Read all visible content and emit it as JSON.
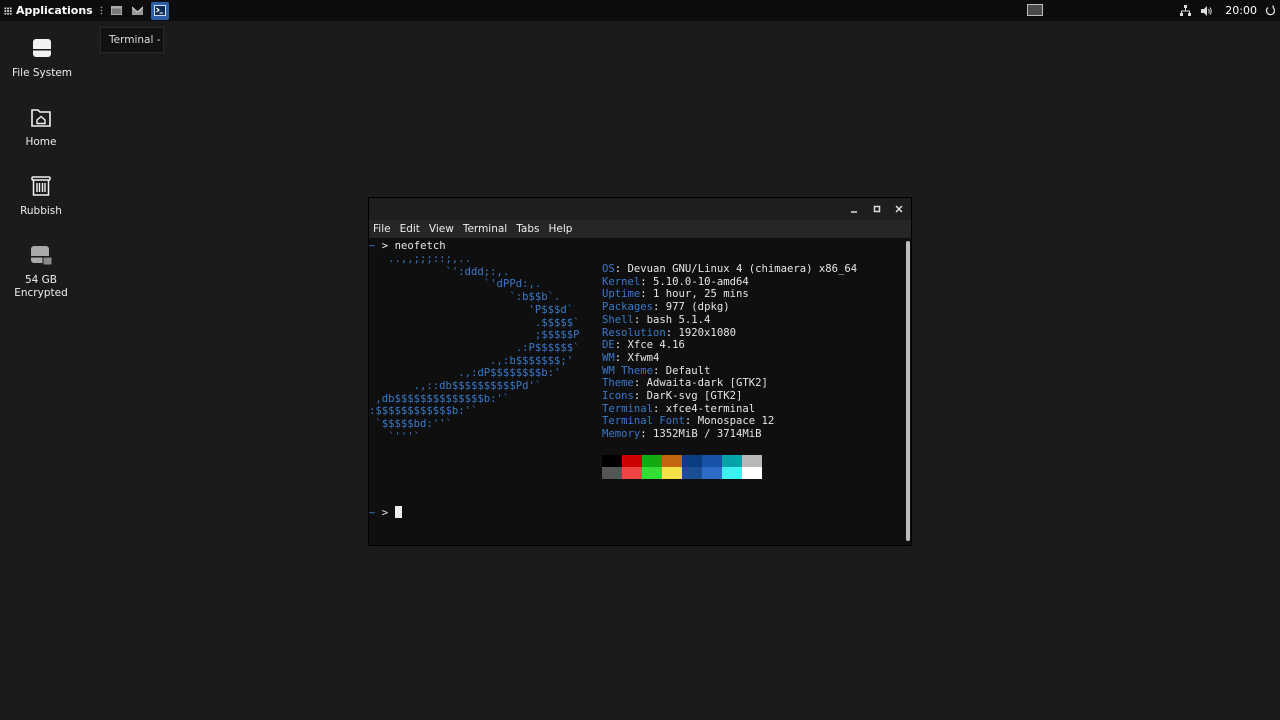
{
  "panel": {
    "applications_label": "Applications",
    "clock": "20:00",
    "launchers": [
      "file-manager",
      "mail-client",
      "terminal"
    ]
  },
  "tooltip": {
    "text": "Terminal -"
  },
  "desktop": {
    "icons": [
      {
        "name": "file-system",
        "label": "File System"
      },
      {
        "name": "home",
        "label": "Home"
      },
      {
        "name": "rubbish",
        "label": "Rubbish"
      },
      {
        "name": "drive",
        "label_line1": "54 GB",
        "label_line2": "Encrypted"
      }
    ]
  },
  "terminal": {
    "menu": [
      "File",
      "Edit",
      "View",
      "Terminal",
      "Tabs",
      "Help"
    ],
    "command": "neofetch",
    "prompt_char": ">",
    "prompt_tilde": "~",
    "logo_lines": [
      "   ..,,;;;::;,..",
      "            `':ddd;:,.",
      "                  `'dPPd:,.",
      "                      `:b$$b`.",
      "                         'P$$$d`",
      "                          .$$$$$`",
      "                          ;$$$$$P",
      "                       .:P$$$$$$`",
      "                   .,:b$$$$$$$;'",
      "              .,:dP$$$$$$$$b:'",
      "       .,::db$$$$$$$$$$Pd'`",
      " ,db$$$$$$$$$$$$$$b:'`",
      ":$$$$$$$$$$$$b:'`",
      " `$$$$$bd:''`",
      "   `'''`"
    ],
    "info": [
      {
        "key": "OS",
        "value": "Devuan GNU/Linux 4 (chimaera) x86_64"
      },
      {
        "key": "Kernel",
        "value": "5.10.0-10-amd64"
      },
      {
        "key": "Uptime",
        "value": "1 hour, 25 mins"
      },
      {
        "key": "Packages",
        "value": "977 (dpkg)"
      },
      {
        "key": "Shell",
        "value": "bash 5.1.4"
      },
      {
        "key": "Resolution",
        "value": "1920x1080"
      },
      {
        "key": "DE",
        "value": "Xfce 4.16"
      },
      {
        "key": "WM",
        "value": "Xfwm4"
      },
      {
        "key": "WM Theme",
        "value": "Default"
      },
      {
        "key": "Theme",
        "value": "Adwaita-dark [GTK2]"
      },
      {
        "key": "Icons",
        "value": "DarK-svg [GTK2]"
      },
      {
        "key": "Terminal",
        "value": "xfce4-terminal"
      },
      {
        "key": "Terminal Font",
        "value": "Monospace 12"
      },
      {
        "key": "Memory",
        "value": "1352MiB / 3714MiB"
      }
    ],
    "palette_top": [
      "#000000",
      "#cc0000",
      "#11aa11",
      "#c4660e",
      "#0a3d82",
      "#1653a8",
      "#07a3a8",
      "#b8b8b8"
    ],
    "palette_bottom": [
      "#555555",
      "#ef4444",
      "#33dd33",
      "#f5e04a",
      "#1c4e93",
      "#2c6bc6",
      "#3ef0f0",
      "#ffffff"
    ]
  }
}
